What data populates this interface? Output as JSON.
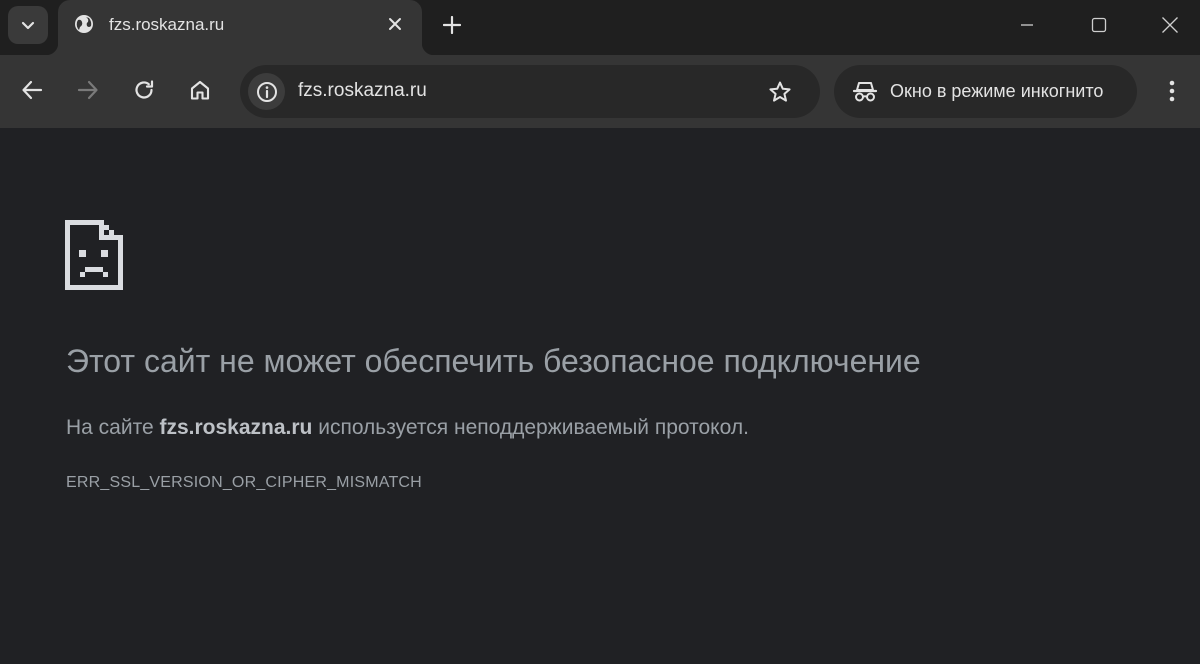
{
  "tab": {
    "title": "fzs.roskazna.ru"
  },
  "toolbar": {
    "url": "fzs.roskazna.ru",
    "incognito_label": "Окно в режиме инкогнито"
  },
  "error": {
    "title": "Этот сайт не может обеспечить безопасное подключение",
    "desc_prefix": "На сайте ",
    "desc_host": "fzs.roskazna.ru",
    "desc_suffix": " используется неподдерживаемый протокол.",
    "code": "ERR_SSL_VERSION_OR_CIPHER_MISMATCH"
  },
  "icons": [
    "chevron-down-icon",
    "globe-icon",
    "close-icon",
    "plus-icon",
    "minimize-icon",
    "maximize-icon",
    "window-close-icon",
    "back-arrow-icon",
    "forward-arrow-icon",
    "reload-icon",
    "home-icon",
    "info-icon",
    "star-icon",
    "incognito-icon",
    "kebab-menu-icon",
    "sad-page-icon"
  ],
  "colors": {
    "page_background": "#202124",
    "tabstrip": "#1f1f1f",
    "toolbar": "#353535",
    "omnibox": "#282828",
    "error_text": "#9aa0a6"
  }
}
